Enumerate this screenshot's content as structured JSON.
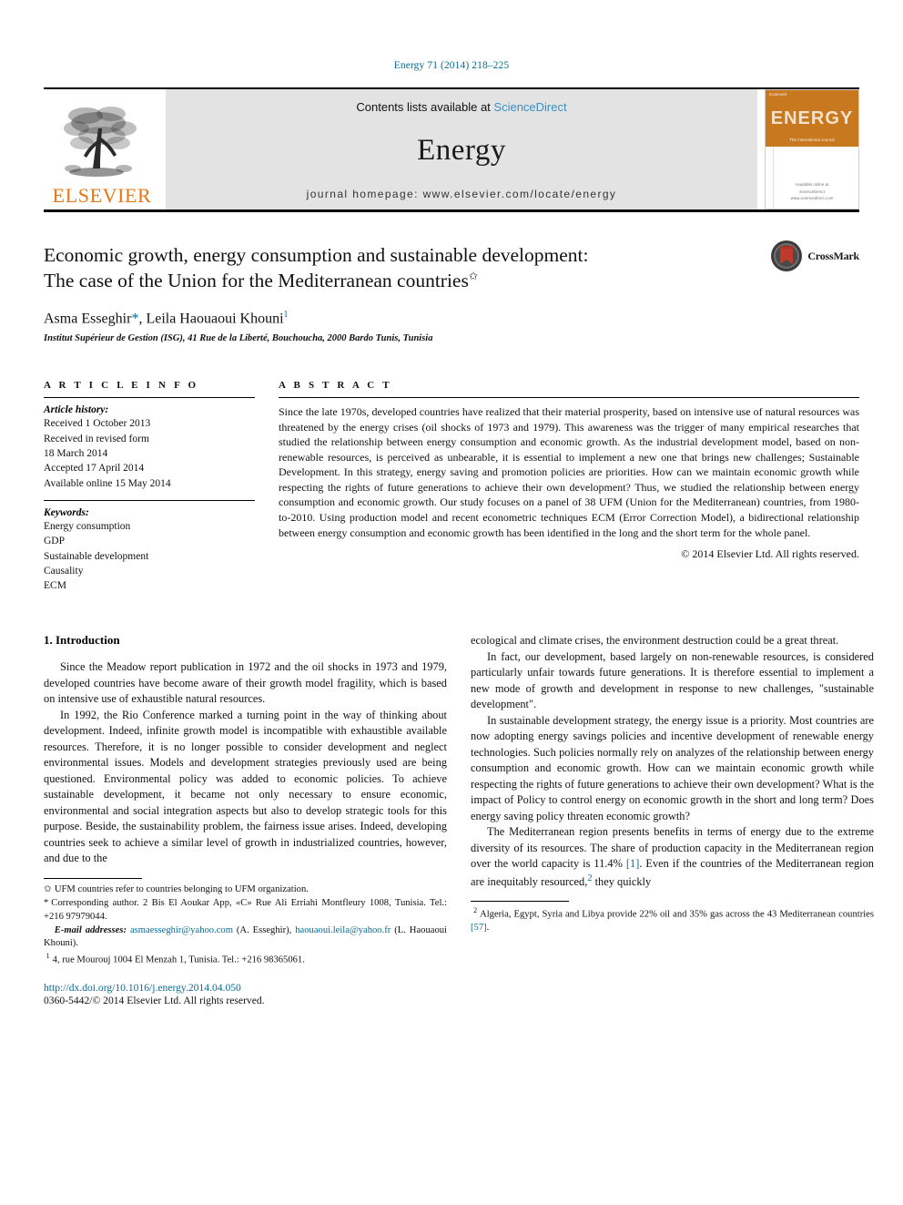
{
  "running_head": "Energy 71 (2014) 218–225",
  "masthead": {
    "publisher_logo_text": "ELSEVIER",
    "contents_prefix": "Contents lists available at ",
    "contents_link": "ScienceDirect",
    "journal_name": "Energy",
    "homepage": "journal homepage: www.elsevier.com/locate/energy",
    "cover": {
      "title": "ENERGY",
      "tiny_top": "ELSEVIER",
      "subtitle": "The international Journal",
      "footer_line1": "Available online at",
      "footer_line2": "ScienceDirect",
      "footer_line3": "www.sciencedirect.com"
    }
  },
  "article": {
    "title_line1": "Economic growth, energy consumption and sustainable development:",
    "title_line2": "The case of the Union for the Mediterranean countries",
    "title_marker": "✩",
    "authors_1": "Asma Esseghir",
    "authors_corr_mark": "*",
    "authors_2": ", Leila Haouaoui Khouni",
    "authors_sup": "1",
    "affiliation": "Institut Supérieur de Gestion (ISG), 41 Rue de la Liberté, Bouchoucha, 2000 Bardo Tunis, Tunisia",
    "crossmark_label": "CrossMark"
  },
  "info": {
    "heading": "A R T I C L E    I N F O",
    "history_label": "Article history:",
    "history": [
      "Received 1 October 2013",
      "Received in revised form",
      "18 March 2014",
      "Accepted 17 April 2014",
      "Available online 15 May 2014"
    ],
    "keywords_label": "Keywords:",
    "keywords": [
      "Energy consumption",
      "GDP",
      "Sustainable development",
      "Causality",
      "ECM"
    ]
  },
  "abstract": {
    "heading": "A B S T R A C T",
    "text": "Since the late 1970s, developed countries have realized that their material prosperity, based on intensive use of natural resources was threatened by the energy crises (oil shocks of 1973 and 1979). This awareness was the trigger of many empirical researches that studied the relationship between energy consumption and economic growth. As the industrial development model, based on non-renewable resources, is perceived as unbearable, it is essential to implement a new one that brings new challenges; Sustainable Development. In this strategy, energy saving and promotion policies are priorities. How can we maintain economic growth while respecting the rights of future generations to achieve their own development? Thus, we studied the relationship between energy consumption and economic growth. Our study focuses on a panel of 38 UFM (Union for the Mediterranean) countries, from 1980-to-2010. Using production model and recent econometric techniques ECM (Error Correction Model), a bidirectional relationship between energy consumption and economic growth has been identified in the long and the short term for the whole panel.",
    "copyright": "© 2014 Elsevier Ltd. All rights reserved."
  },
  "body": {
    "section_title": "1. Introduction",
    "left_paragraphs": [
      "Since the Meadow report publication in 1972 and the oil shocks in 1973 and 1979, developed countries have become aware of their growth model fragility, which is based on intensive use of exhaustible natural resources.",
      "In 1992, the Rio Conference marked a turning point in the way of thinking about development. Indeed, infinite growth model is incompatible with exhaustible available resources. Therefore, it is no longer possible to consider development and neglect environmental issues. Models and development strategies previously used are being questioned. Environmental policy was added to economic policies. To achieve sustainable development, it became not only necessary to ensure economic, environmental and social integration aspects but also to develop strategic tools for this purpose. Beside, the sustainability problem, the fairness issue arises. Indeed, developing countries seek to achieve a similar level of growth in industrialized countries, however, and due to the"
    ],
    "right_paragraphs": [
      "ecological and climate crises, the environment destruction could be a great threat.",
      "In fact, our development, based largely on non-renewable resources, is considered particularly unfair towards future generations. It is therefore essential to implement a new mode of growth and development in response to new challenges, \"sustainable development\".",
      "In sustainable development strategy, the energy issue is a priority. Most countries are now adopting energy savings policies and incentive development of renewable energy technologies. Such policies normally rely on analyzes of the relationship between energy consumption and economic growth. How can we maintain economic growth while respecting the rights of future generations to achieve their own development? What is the impact of Policy to control energy on economic growth in the short and long term? Does energy saving policy threaten economic growth?"
    ],
    "right_last_paragraph_a": "The Mediterranean region presents benefits in terms of energy due to the extreme diversity of its resources. The share of production capacity in the Mediterranean region over the world capacity is 11.4% ",
    "right_last_citation": "[1]",
    "right_last_paragraph_b": ". Even if the countries of the Mediterranean region are inequitably resourced,",
    "right_last_sup": "2",
    "right_last_paragraph_c": " they quickly"
  },
  "footnotes": {
    "left": [
      {
        "mark": "✩",
        "text": "UFM countries refer to countries belonging to UFM organization."
      },
      {
        "mark": "*",
        "text": "Corresponding author. 2 Bis El Aoukar App, «C» Rue Ali Erriahi Montfleury 1008, Tunisia. Tel.: +216 97979044."
      }
    ],
    "email_label": "E-mail addresses:",
    "email_1": "asmaesseghir@yahoo.com",
    "email_1_name": " (A. Esseghir), ",
    "email_2": "haouaoui.leila@yahoo.fr",
    "email_2_name": " (L. Haouaoui Khouni).",
    "note_1_mark": "1",
    "note_1_text": "4, rue Mourouj 1004 El Menzah 1, Tunisia. Tel.: +216 98365061.",
    "doi": "http://dx.doi.org/10.1016/j.energy.2014.04.050",
    "issn": "0360-5442/© 2014 Elsevier Ltd. All rights reserved.",
    "right_mark": "2",
    "right_text_a": "Algeria, Egypt, Syria and Libya provide 22% oil and 35% gas across the 43 Mediterranean countries ",
    "right_citation": "[57]",
    "right_text_b": "."
  },
  "colors": {
    "link_blue": "#0b6a94",
    "elsevier_orange": "#e87511",
    "cover_orange": "#c8791f",
    "masthead_gray": "#e3e3e3"
  }
}
